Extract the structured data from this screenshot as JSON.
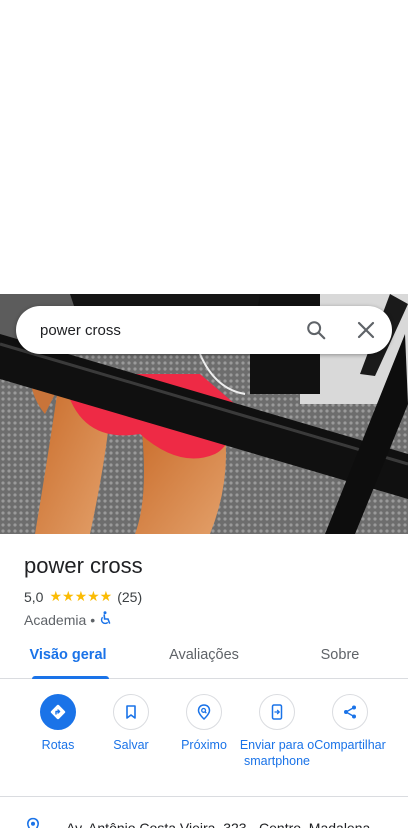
{
  "search": {
    "query": "power cross"
  },
  "place": {
    "title": "power cross",
    "rating": "5,0",
    "stars": "★★★★★",
    "review_count": "(25)",
    "category": "Academia",
    "separator": "•"
  },
  "tabs": [
    {
      "label": "Visão geral"
    },
    {
      "label": "Avaliações"
    },
    {
      "label": "Sobre"
    }
  ],
  "actions": [
    {
      "label": "Rotas"
    },
    {
      "label": "Salvar"
    },
    {
      "label": "Próximo"
    },
    {
      "label": "Enviar para o smartphone"
    },
    {
      "label": "Compartilhar"
    }
  ],
  "address": {
    "text": "Av. Antônio Costa Vieira, 323 - Centro, Madalena"
  },
  "colors": {
    "accent": "#1a73e8",
    "star": "#fbbc04"
  }
}
